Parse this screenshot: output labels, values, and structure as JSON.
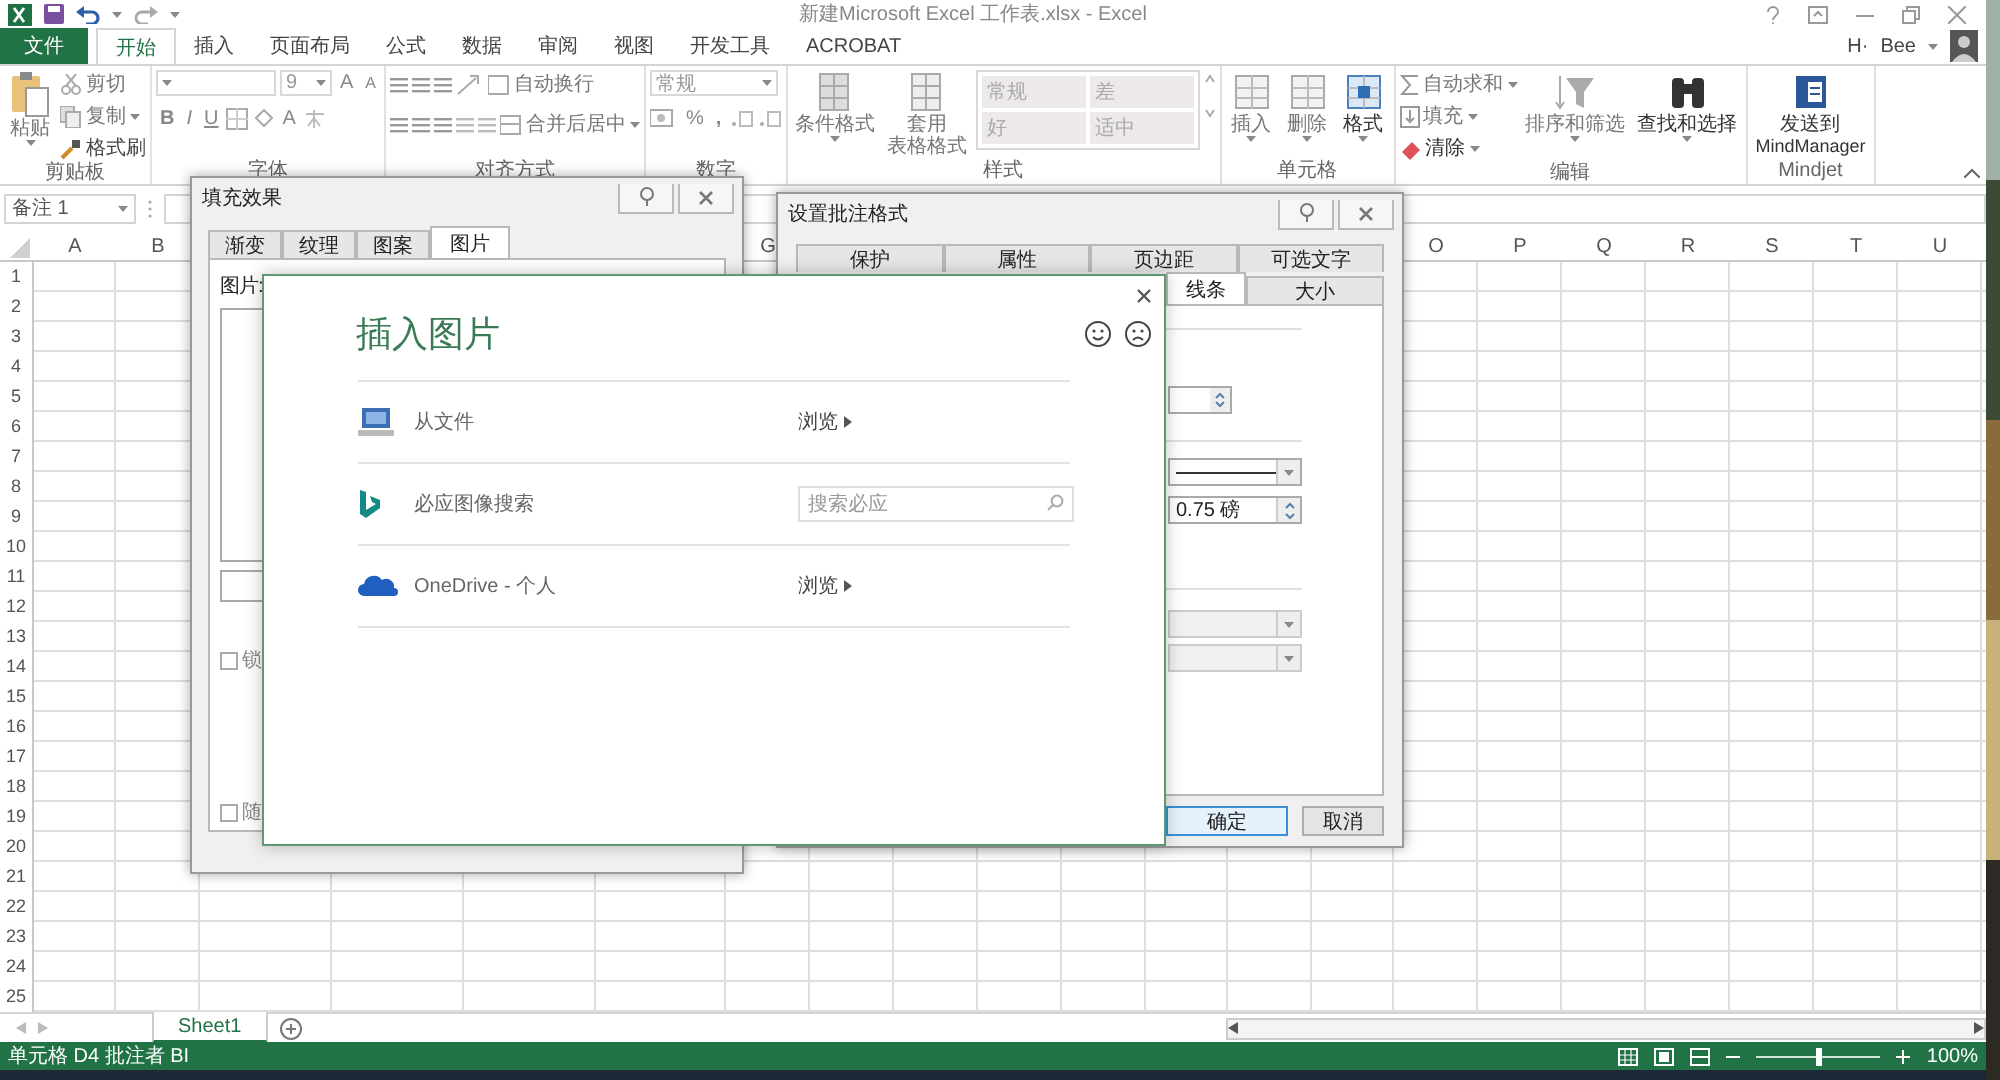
{
  "title_bar": {
    "title": "新建Microsoft Excel 工作表.xlsx - Excel"
  },
  "ribbon_tabs": [
    {
      "label": "文件",
      "kind": "file",
      "selected": false
    },
    {
      "label": "开始",
      "kind": "tab",
      "selected": true
    },
    {
      "label": "插入",
      "kind": "tab",
      "selected": false
    },
    {
      "label": "页面布局",
      "kind": "tab",
      "selected": false
    },
    {
      "label": "公式",
      "kind": "tab",
      "selected": false
    },
    {
      "label": "数据",
      "kind": "tab",
      "selected": false
    },
    {
      "label": "审阅",
      "kind": "tab",
      "selected": false
    },
    {
      "label": "视图",
      "kind": "tab",
      "selected": false
    },
    {
      "label": "开发工具",
      "kind": "tab",
      "selected": false
    },
    {
      "label": "ACROBAT",
      "kind": "tab",
      "selected": false
    }
  ],
  "account": {
    "initials": "H·",
    "user": "Bee"
  },
  "ribbon": {
    "clipboard": {
      "paste": "粘贴",
      "cut": "剪切",
      "copy": "复制",
      "painter": "格式刷",
      "label": "剪贴板"
    },
    "font": {
      "size": "9",
      "grow": "A",
      "shrink": "A",
      "bold": "B",
      "italic": "I",
      "underline": "U",
      "font_color_button": "A",
      "label": "字体"
    },
    "alignment": {
      "wrap": "自动换行",
      "merge": "合并后居中",
      "label": "对齐方式"
    },
    "number": {
      "format": "常规",
      "percent": "%",
      "comma": ",",
      "label": "数字"
    },
    "styles": {
      "conditional": "条件格式",
      "table_format": [
        "套用",
        "表格格式"
      ],
      "gallery": [
        "常规",
        "差",
        "好",
        "适中"
      ],
      "label": "样式"
    },
    "cells": {
      "buttons": [
        "插入",
        "删除",
        "格式"
      ],
      "label": "单元格"
    },
    "editing": {
      "autosum": "自动求和",
      "fill": "填充",
      "clear": "清除",
      "sort": "排序和筛选",
      "find": "查找和选择",
      "label": "编辑"
    },
    "mindjet": {
      "send": [
        "发送到",
        "MindManager"
      ],
      "label": "Mindjet"
    }
  },
  "name_box": "备注 1",
  "column_headers": [
    "A",
    "B",
    "G",
    "O",
    "P",
    "Q",
    "R",
    "S",
    "T",
    "U"
  ],
  "row_headers": [
    "1",
    "2",
    "3",
    "4",
    "5",
    "6",
    "7",
    "8",
    "9",
    "10",
    "11",
    "12",
    "13",
    "14",
    "15",
    "16",
    "17",
    "18",
    "19",
    "20",
    "21",
    "22",
    "23",
    "24",
    "25"
  ],
  "sheet_tabs": [
    {
      "label": "Sheet1",
      "selected": true
    }
  ],
  "status_bar": {
    "text": "单元格 D4 批注者 BI",
    "zoom": {
      "level": 0.5,
      "reading": "100%"
    }
  },
  "fill_effects_dialog": {
    "title": "填充效果",
    "tabs": [
      {
        "label": "渐变",
        "selected": false
      },
      {
        "label": "纹理",
        "selected": false
      },
      {
        "label": "图案",
        "selected": false
      },
      {
        "label": "图片",
        "selected": true
      }
    ],
    "picture_label": "图片:",
    "checkboxes": [
      {
        "label": "锁",
        "checked": false
      },
      {
        "label": "随",
        "checked": false
      }
    ]
  },
  "format_comment_dialog": {
    "title": "设置批注格式",
    "tabs_top": [
      {
        "label": "保护",
        "selected": false
      },
      {
        "label": "属性",
        "selected": false
      },
      {
        "label": "页边距",
        "selected": false
      },
      {
        "label": "可选文字",
        "selected": false
      }
    ],
    "tabs_bottom": [
      {
        "label": "线条",
        "selected": true
      },
      {
        "label": "大小",
        "selected": false
      }
    ],
    "line_weight": "0.75 磅",
    "buttons": [
      {
        "label": "确定",
        "default": true
      },
      {
        "label": "取消",
        "default": false
      }
    ]
  },
  "insert_picture_dialog": {
    "title": "插入图片",
    "sources": [
      {
        "kind": "file",
        "label": "从文件",
        "action": "浏览"
      },
      {
        "kind": "bing",
        "label": "必应图像搜索",
        "placeholder": "搜索必应"
      },
      {
        "kind": "onedrive",
        "label": "OneDrive - 个人",
        "action": "浏览"
      }
    ]
  }
}
